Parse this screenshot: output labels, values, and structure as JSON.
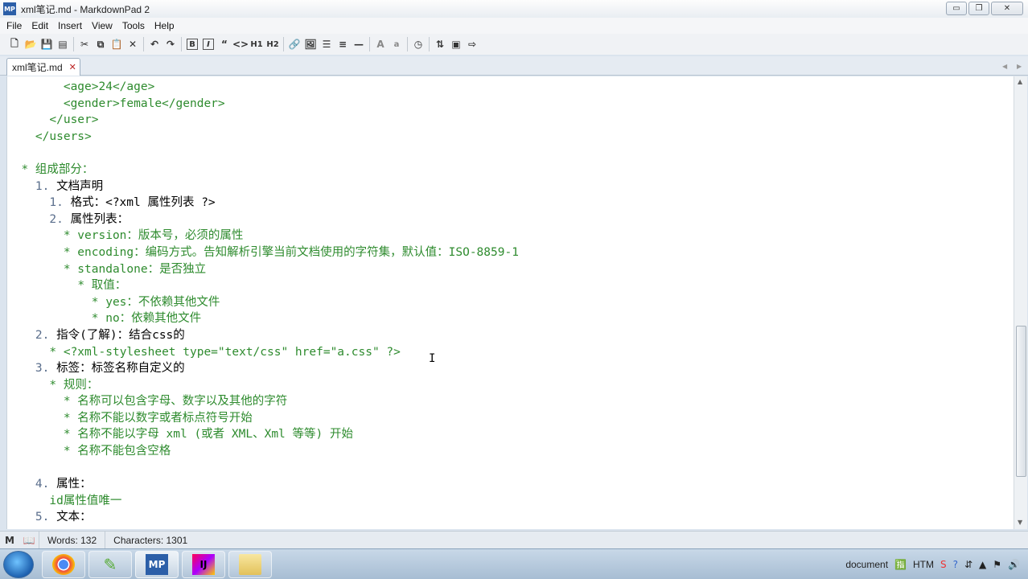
{
  "window": {
    "title": "xml笔记.md - MarkdownPad 2",
    "app_icon_text": "MP",
    "minimize": "▭",
    "maximize": "❐",
    "close": "✕"
  },
  "menu": [
    "File",
    "Edit",
    "Insert",
    "View",
    "Tools",
    "Help"
  ],
  "toolbar": {
    "bold": "B",
    "italic": "I",
    "quote": "“",
    "code": "<>",
    "h1": "H1",
    "h2": "H2",
    "font_large": "A",
    "font_small": "a"
  },
  "tab": {
    "label": "xml笔记.md",
    "close": "✕"
  },
  "editor": {
    "lines": [
      {
        "indent": "        ",
        "text": "<age>24</age>",
        "cls": "g"
      },
      {
        "indent": "        ",
        "text": "<gender>female</gender>",
        "cls": "g"
      },
      {
        "indent": "      ",
        "text": "</user>",
        "cls": "g"
      },
      {
        "indent": "    ",
        "text": "</users>",
        "cls": "g"
      },
      {
        "indent": "",
        "text": "",
        "cls": "g"
      },
      {
        "indent": "  ",
        "text": "* 组成部分：",
        "cls": "g"
      },
      {
        "indent": "    ",
        "num": "1. ",
        "text": "文档声明",
        "cls": "k"
      },
      {
        "indent": "      ",
        "num": "1. ",
        "text": "格式：<?xml 属性列表 ?>",
        "cls": "k"
      },
      {
        "indent": "      ",
        "num": "2. ",
        "text": "属性列表：",
        "cls": "k"
      },
      {
        "indent": "        ",
        "text": "* version：版本号，必须的属性",
        "cls": "g"
      },
      {
        "indent": "        ",
        "text": "* encoding：编码方式。告知解析引擎当前文档使用的字符集，默认值：ISO-8859-1",
        "cls": "g"
      },
      {
        "indent": "        ",
        "text": "* standalone：是否独立",
        "cls": "g"
      },
      {
        "indent": "          ",
        "text": "* 取值：",
        "cls": "g"
      },
      {
        "indent": "            ",
        "text": "* yes：不依赖其他文件",
        "cls": "g"
      },
      {
        "indent": "            ",
        "text": "* no：依赖其他文件",
        "cls": "g"
      },
      {
        "indent": "    ",
        "num": "2. ",
        "text": "指令(了解)：结合css的",
        "cls": "k"
      },
      {
        "indent": "      ",
        "text": "* <?xml-stylesheet type=\"text/css\" href=\"a.css\" ?>",
        "cls": "g"
      },
      {
        "indent": "    ",
        "num": "3. ",
        "text": "标签：标签名称自定义的",
        "cls": "k"
      },
      {
        "indent": "      ",
        "text": "* 规则：",
        "cls": "g"
      },
      {
        "indent": "        ",
        "text": "* 名称可以包含字母、数字以及其他的字符",
        "cls": "g"
      },
      {
        "indent": "        ",
        "text": "* 名称不能以数字或者标点符号开始",
        "cls": "g"
      },
      {
        "indent": "        ",
        "text": "* 名称不能以字母 xml (或者 XML、Xml 等等) 开始",
        "cls": "g"
      },
      {
        "indent": "        ",
        "text": "* 名称不能包含空格",
        "cls": "g"
      },
      {
        "indent": "",
        "text": "",
        "cls": "g"
      },
      {
        "indent": "    ",
        "num": "4. ",
        "text": "属性：",
        "cls": "k"
      },
      {
        "indent": "      ",
        "text": "id属性值唯一",
        "cls": "g"
      },
      {
        "indent": "    ",
        "num": "5. ",
        "text": "文本：",
        "cls": "k"
      }
    ]
  },
  "status": {
    "words": "Words: 132",
    "characters": "Characters: 1301"
  },
  "taskbar": {
    "apps": [
      "chrome",
      "notepad",
      "MP",
      "IJ",
      "folder"
    ],
    "tray_document": "document",
    "tray_htm": "HTM"
  }
}
